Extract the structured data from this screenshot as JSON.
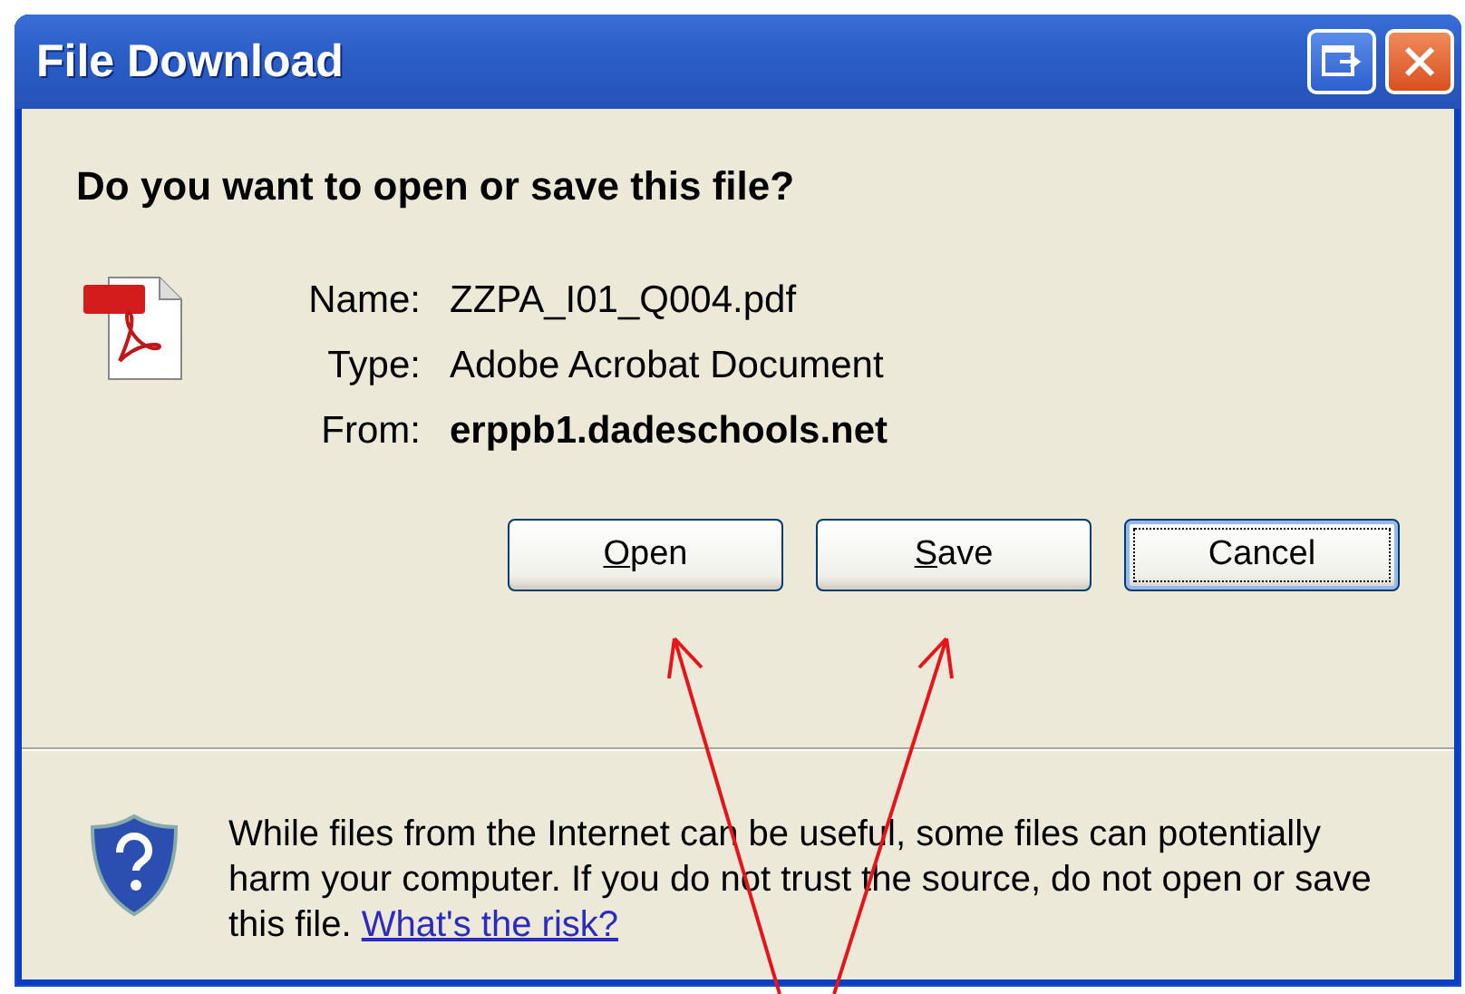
{
  "window": {
    "title": "File Download"
  },
  "question": "Do you want to open or save this file?",
  "fields": [
    {
      "label": "Name:",
      "value": "ZZPA_I01_Q004.pdf",
      "bold": false
    },
    {
      "label": "Type:",
      "value": "Adobe Acrobat Document",
      "bold": false
    },
    {
      "label": "From:",
      "value": "erppb1.dadeschools.net",
      "bold": true
    }
  ],
  "buttons": [
    {
      "key": "O",
      "rest": "pen",
      "focused": false
    },
    {
      "key": "S",
      "rest": "ave",
      "focused": false
    },
    {
      "rest": "Cancel",
      "focused": true
    }
  ],
  "warning": {
    "text": "While files from the Internet can be useful, some files can potentially harm your computer. If you do not trust the source, do not open or save this file.",
    "link": "What's the risk?"
  }
}
